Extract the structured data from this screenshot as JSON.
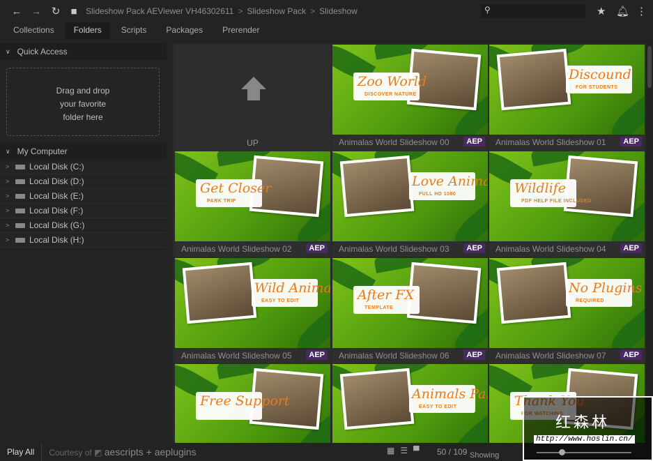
{
  "breadcrumb": [
    "Slideshow Pack AEViewer VH46302611",
    "Slideshow Pack",
    "Slideshow"
  ],
  "tabs": [
    "Collections",
    "Folders",
    "Scripts",
    "Packages",
    "Prerender"
  ],
  "active_tab": "Folders",
  "sidebar": {
    "quick_access": "Quick Access",
    "drop_text": [
      "Drag and drop",
      "your favorite",
      "folder here"
    ],
    "my_computer": "My Computer",
    "disks": [
      "Local Disk (C:)",
      "Local Disk (D:)",
      "Local Disk (E:)",
      "Local Disk (F:)",
      "Local Disk (G:)",
      "Local Disk (H:)"
    ]
  },
  "up_label": "UP",
  "badge": "AEP",
  "tiles": [
    {
      "name": "Animalas World Slideshow 00",
      "title": "Zoo World",
      "sub": "DISCOVER NATURE"
    },
    {
      "name": "Animalas World Slideshow 01",
      "title": "Discound",
      "sub": "FOR STUDENTS"
    },
    {
      "name": "Animalas World Slideshow 02",
      "title": "Get Closer",
      "sub": "PARK TRIP"
    },
    {
      "name": "Animalas World Slideshow 03",
      "title": "Love Animals",
      "sub": "FULL HD 1080"
    },
    {
      "name": "Animalas World Slideshow 04",
      "title": "Wildlife",
      "sub": "PDF HELP FILE INCLUDED"
    },
    {
      "name": "Animalas World Slideshow 05",
      "title": "Wild Animals",
      "sub": "EASY TO EDIT"
    },
    {
      "name": "Animalas World Slideshow 06",
      "title": "After FX",
      "sub": "TEMPLATE"
    },
    {
      "name": "Animalas World Slideshow 07",
      "title": "No Plugins",
      "sub": "REQUIRED"
    },
    {
      "name": "",
      "title": "Free Support",
      "sub": ""
    },
    {
      "name": "",
      "title": "Animals Park",
      "sub": "EASY TO EDIT"
    },
    {
      "name": "",
      "title": "Thank You",
      "sub": "FOR WATCHING"
    }
  ],
  "footer": {
    "play_all": "Play All",
    "courtesy": "Courtesy of",
    "brand": "aescripts + aeplugins",
    "count": "50 / 109",
    "showing": "Showing"
  },
  "watermark": {
    "text": "红森林",
    "url": "http://www.hoslin.cn/"
  },
  "colors": {
    "accent_badge": "#4a2a63",
    "title_orange": "#e77b1e"
  }
}
